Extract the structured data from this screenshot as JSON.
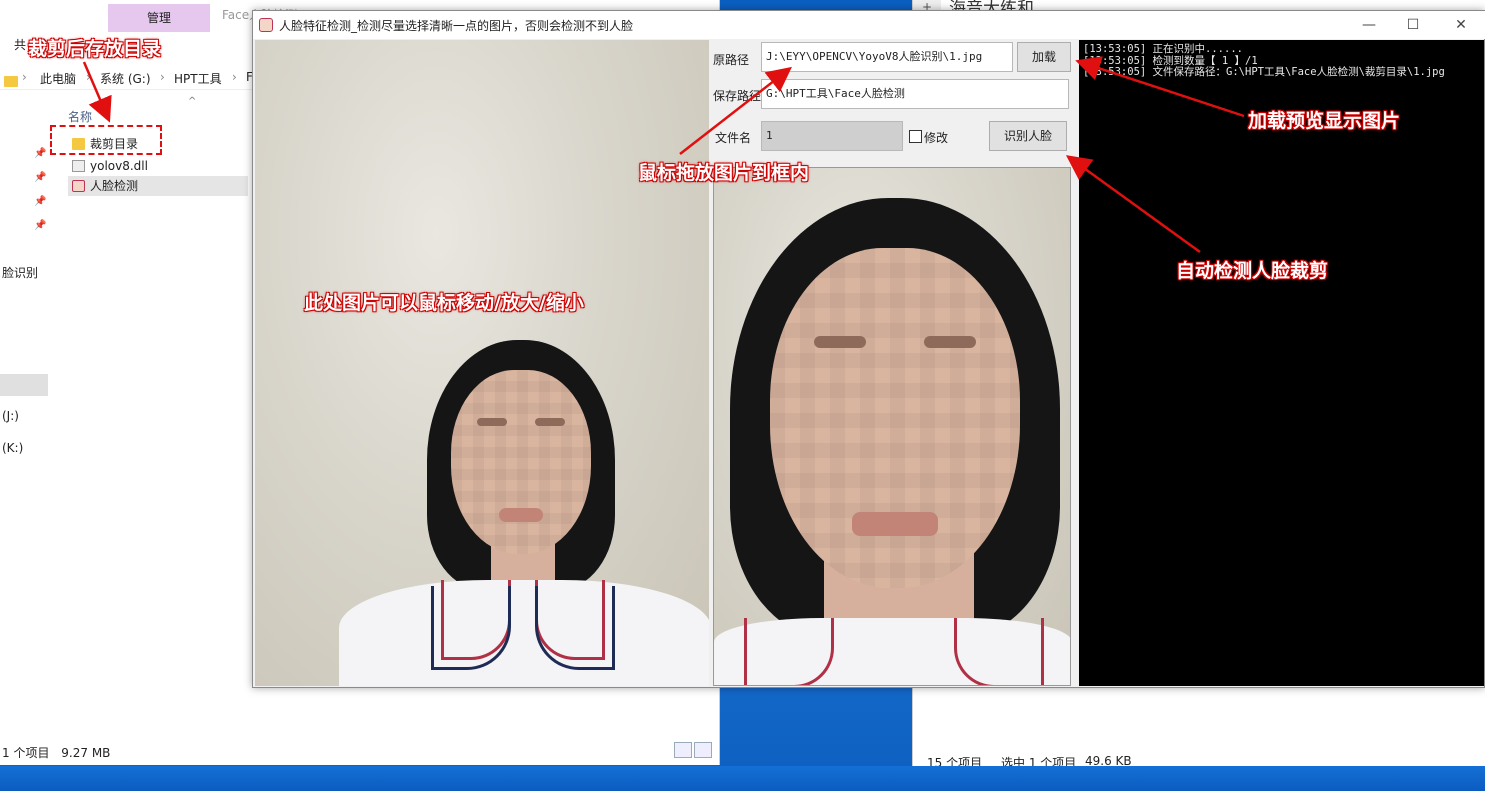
{
  "explorer_left": {
    "ribbon_tab_manage": "管理",
    "ribbon_tab_face": "Face人脸检测",
    "share_label": "共",
    "breadcrumb": [
      "此电脑",
      "系统 (G:)",
      "HPT工具",
      "F"
    ],
    "column_name": "名称",
    "files": [
      {
        "name": "裁剪目录",
        "icon": "folder-icon"
      },
      {
        "name": "yolov8.dll",
        "icon": "dll-file-icon"
      },
      {
        "name": "人脸检测",
        "icon": "app-exe-icon"
      }
    ],
    "side_items": [
      "脸识别",
      "(J:)",
      "(K:)"
    ],
    "status_count": "1 个项目",
    "status_size": "9.27 MB"
  },
  "explorer_right": {
    "title": "海音大练和",
    "tab_plus": "+",
    "status_count": "15 个项目",
    "status_selected": "选中 1 个项目",
    "status_size": "49.6 KB"
  },
  "app": {
    "title": "人脸特征检测_检测尽量选择清晰一点的图片，否则会检测不到人脸",
    "window_controls": {
      "minimize": "—",
      "maximize": "☐",
      "close": "✕"
    },
    "source_path_label": "原路径",
    "source_path_value": "J:\\EYY\\OPENCV\\YoyoV8人脸识别\\1.jpg",
    "load_button": "加载",
    "save_path_label": "保存路径",
    "save_path_value": "G:\\HPT工具\\Face人脸检测",
    "filename_label": "文件名",
    "filename_value": "1",
    "modify_checkbox_label": "修改",
    "detect_button": "识别人脸",
    "console_lines": [
      "[13:53:05] 正在识别中......",
      "[13:53:05] 检测到数量【 1 】/1",
      "[13:53:05] 文件保存路径：G:\\HPT工具\\Face人脸检测\\裁剪目录\\1.jpg"
    ]
  },
  "annotations": {
    "crop_dir": "裁剪后存放目录",
    "drag_drop": "鼠标拖放图片到框内",
    "load_preview": "加载预览显示图片",
    "auto_detect": "自动检测人脸裁剪",
    "image_hint": "此处图片可以鼠标移动/放大/缩小"
  },
  "colors": {
    "annotation_red": "#e01010",
    "console_bg": "#000000",
    "ribbon_manage": "#e6c8ef"
  }
}
